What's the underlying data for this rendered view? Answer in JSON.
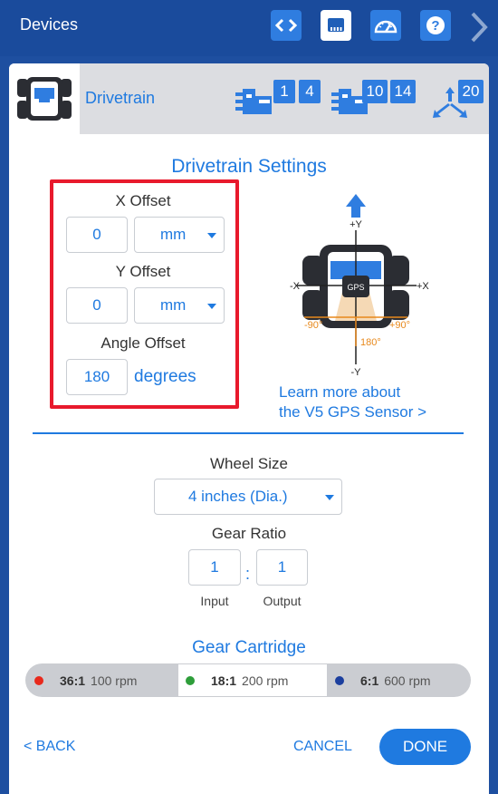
{
  "topbar": {
    "title": "Devices",
    "buttons": [
      {
        "icon": "code-icon"
      },
      {
        "icon": "devices-icon"
      },
      {
        "icon": "dashboard-icon"
      },
      {
        "icon": "help-icon"
      }
    ],
    "next_icon": "chevron-right-icon"
  },
  "device": {
    "name": "Drivetrain",
    "port_groups": [
      {
        "icon": "motor-group-icon",
        "ports": [
          "1",
          "4"
        ]
      },
      {
        "icon": "motor-group-icon",
        "ports": [
          "10",
          "14"
        ]
      },
      {
        "icon": "gps-sensor-icon",
        "ports": [
          "20"
        ]
      }
    ]
  },
  "settings": {
    "title": "Drivetrain Settings",
    "x_offset": {
      "label": "X Offset",
      "value": "0",
      "unit": "mm"
    },
    "y_offset": {
      "label": "Y Offset",
      "value": "0",
      "unit": "mm"
    },
    "angle_offset": {
      "label": "Angle Offset",
      "value": "180",
      "unit": "degrees"
    },
    "diagram": {
      "plus_y": "+Y",
      "minus_y": "-Y",
      "plus_x": "+X",
      "minus_x": "-X",
      "gps": "GPS",
      "neg90": "-90°",
      "pos90": "+90°",
      "deg180": "180°"
    },
    "learn_more": [
      "Learn more about",
      "the V5 GPS Sensor >"
    ]
  },
  "wheel": {
    "label": "Wheel Size",
    "value": "4 inches (Dia.)"
  },
  "gear_ratio": {
    "label": "Gear Ratio",
    "input_value": "1",
    "output_value": "1",
    "input_label": "Input",
    "output_label": "Output",
    "separator": ":"
  },
  "cartridge": {
    "title": "Gear Cartridge",
    "options": [
      {
        "ratio": "36:1",
        "rpm": "100 rpm",
        "color": "#e8291c",
        "selected": false
      },
      {
        "ratio": "18:1",
        "rpm": "200 rpm",
        "color": "#2e9e3a",
        "selected": true
      },
      {
        "ratio": "6:1",
        "rpm": "600 rpm",
        "color": "#1c3f9e",
        "selected": false
      }
    ]
  },
  "footer": {
    "back": "< BACK",
    "cancel": "CANCEL",
    "done": "DONE"
  },
  "colors": {
    "accent": "#1f7ae0",
    "topbar": "#1a4b9c",
    "highlight": "#e8192c"
  }
}
